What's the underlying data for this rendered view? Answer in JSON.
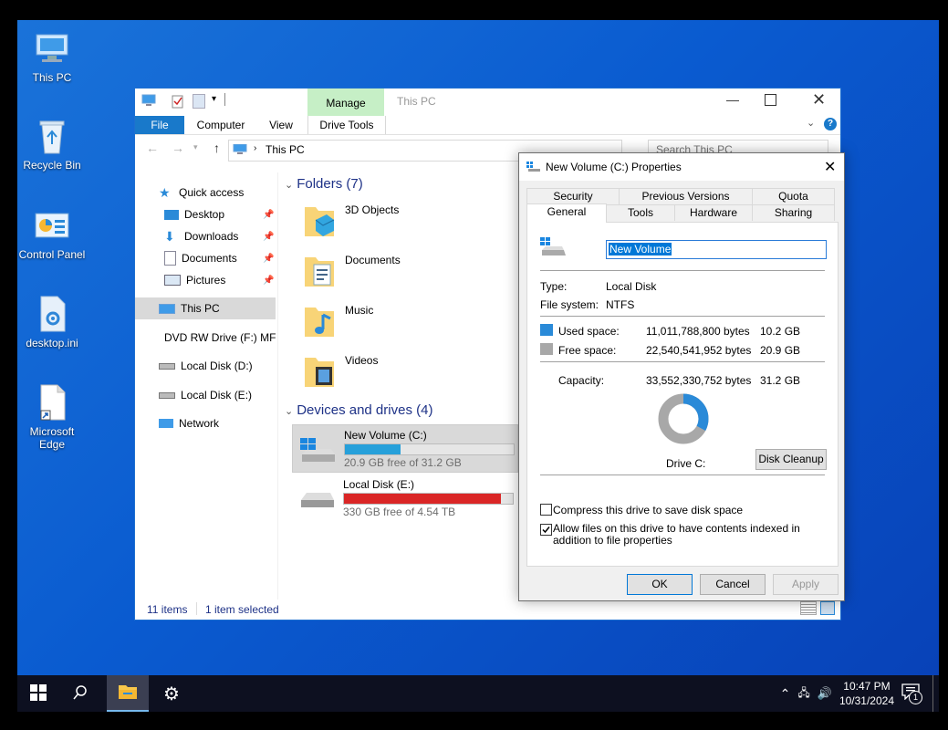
{
  "desktop": {
    "icons": [
      {
        "label": "This PC"
      },
      {
        "label": "Recycle Bin"
      },
      {
        "label": "Control Panel"
      },
      {
        "label": "desktop.ini"
      },
      {
        "label": "Microsoft Edge"
      }
    ]
  },
  "explorer": {
    "title": "This PC",
    "context_tab": "Manage",
    "tabs": {
      "file": "File",
      "computer": "Computer",
      "view": "View",
      "drive_tools": "Drive Tools"
    },
    "address": "This PC",
    "search_placeholder": "Search This PC",
    "nav": {
      "quick_access": "Quick access",
      "desktop": "Desktop",
      "downloads": "Downloads",
      "documents": "Documents",
      "pictures": "Pictures",
      "this_pc": "This PC",
      "dvd": "DVD RW Drive (F:) MF",
      "local_d": "Local Disk (D:)",
      "local_e": "Local Disk (E:)",
      "network": "Network"
    },
    "folders_header": "Folders (7)",
    "folders": {
      "f1": "3D Objects",
      "f2": "Documents",
      "f3": "Music",
      "f4": "Videos"
    },
    "devices_header": "Devices and drives (4)",
    "drives": {
      "c_name": "New Volume (C:)",
      "c_free": "20.9 GB free of 31.2 GB",
      "c_used_fraction": 0.33,
      "e_name": "Local Disk (E:)",
      "e_free": "330 GB free of 4.54 TB",
      "e_used_fraction": 0.93
    },
    "status": {
      "items": "11 items",
      "selected": "1 item selected"
    }
  },
  "dialog": {
    "title": "New Volume (C:) Properties",
    "tabs": {
      "security": "Security",
      "previous_versions": "Previous Versions",
      "quota": "Quota",
      "general": "General",
      "tools": "Tools",
      "hardware": "Hardware",
      "sharing": "Sharing"
    },
    "volume_name": "New Volume",
    "type_label": "Type:",
    "type_value": "Local Disk",
    "fs_label": "File system:",
    "fs_value": "NTFS",
    "used_label": "Used space:",
    "used_bytes": "11,011,788,800 bytes",
    "used_gb": "10.2 GB",
    "free_label": "Free space:",
    "free_bytes": "22,540,541,952 bytes",
    "free_gb": "20.9 GB",
    "capacity_label": "Capacity:",
    "capacity_bytes": "33,552,330,752 bytes",
    "capacity_gb": "31.2 GB",
    "used_fraction": 0.328,
    "drive_label": "Drive C:",
    "cleanup": "Disk Cleanup",
    "compress": "Compress this drive to save disk space",
    "compress_checked": false,
    "index": "Allow files on this drive to have contents indexed in addition to file properties",
    "index_checked": true,
    "ok": "OK",
    "cancel": "Cancel",
    "apply": "Apply",
    "colors": {
      "used": "#2a8ad8",
      "free": "#a8a8a8"
    }
  },
  "taskbar": {
    "time": "10:47 PM",
    "date": "10/31/2024",
    "notifications_badge": "1"
  }
}
